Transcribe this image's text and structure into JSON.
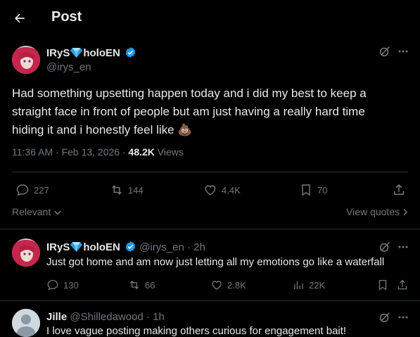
{
  "header": {
    "title": "Post"
  },
  "main_post": {
    "display_name": "IRyS",
    "name_suffix": "holoEN",
    "handle": "@irys_en",
    "text_lines": [
      "Had something upsetting happen today and i did my best to keep a",
      "straight face in front of people but am just having a really hard time",
      "hiding it and i honestly  feel like"
    ],
    "emoji": "💩",
    "time": "11:36 AM",
    "date": "Feb 13, 2026",
    "views_count": "48.2K",
    "views_label": "Views",
    "replies": "227",
    "reposts": "144",
    "likes": "4.4K",
    "bookmarks": "70",
    "sort_label": "Relevant",
    "view_quotes_label": "View quotes"
  },
  "replies": [
    {
      "display_name": "IRyS",
      "name_suffix": "holoEN",
      "handle": "@irys_en",
      "time": "2h",
      "text": "Just got home and am now just letting all my emotions go like a waterfall",
      "replies": "130",
      "reposts": "66",
      "likes": "2.8K",
      "views": "22K"
    },
    {
      "display_name": "Jille",
      "handle": "@Shilledawood",
      "time": "1h",
      "text": "I love vague posting making others curious for engagement bait!"
    }
  ],
  "colors": {
    "background": "#000000",
    "text": "#e7e9ea",
    "muted": "#71767b",
    "verified": "#1d9bf0",
    "divider": "#2f3336"
  }
}
